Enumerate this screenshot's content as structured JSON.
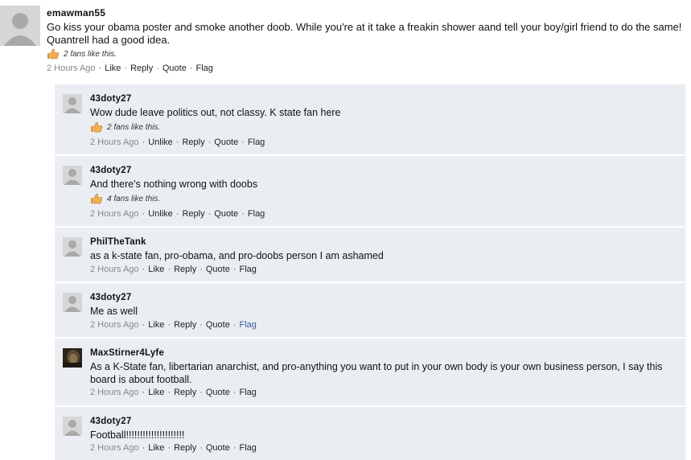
{
  "top_comment": {
    "username": "emawman55",
    "body": "Go kiss your obama poster and smoke another doob. While you're at it take a freakin shower aand tell your boy/girl friend to do the same! Quantrell had a good idea.",
    "fans": "2 fans like this.",
    "time": "2 Hours Ago",
    "actions": [
      "Like",
      "Reply",
      "Quote",
      "Flag"
    ]
  },
  "replies": [
    {
      "username": "43doty27",
      "body": "Wow dude leave politics out, not classy. K state fan here",
      "fans": "2 fans like this.",
      "time": "2 Hours Ago",
      "actions": [
        "Unlike",
        "Reply",
        "Quote",
        "Flag"
      ]
    },
    {
      "username": "43doty27",
      "body": "And there's nothing wrong with doobs",
      "fans": "4 fans like this.",
      "time": "2 Hours Ago",
      "actions": [
        "Unlike",
        "Reply",
        "Quote",
        "Flag"
      ]
    },
    {
      "username": "PhilTheTank",
      "body": "as a k-state fan, pro-obama, and pro-doobs person I am ashamed",
      "time": "2 Hours Ago",
      "actions": [
        "Like",
        "Reply",
        "Quote",
        "Flag"
      ]
    },
    {
      "username": "43doty27",
      "body": "Me as well",
      "time": "2 Hours Ago",
      "actions": [
        "Like",
        "Reply",
        "Quote",
        "Flag"
      ]
    },
    {
      "username": "MaxStirner4Lyfe",
      "body": "As a K-State fan, libertarian anarchist, and pro-anything you want to put in your own body is your own business person, I say this board is about football.",
      "time": "2 Hours Ago",
      "actions": [
        "Like",
        "Reply",
        "Quote",
        "Flag"
      ]
    },
    {
      "username": "43doty27",
      "body": "Football!!!!!!!!!!!!!!!!!!!!!",
      "time": "2 Hours Ago",
      "actions": [
        "Like",
        "Reply",
        "Quote",
        "Flag"
      ]
    }
  ],
  "colors": {
    "reply_background": "#eaeef2",
    "flag_hover_link": "#3b5b99"
  }
}
